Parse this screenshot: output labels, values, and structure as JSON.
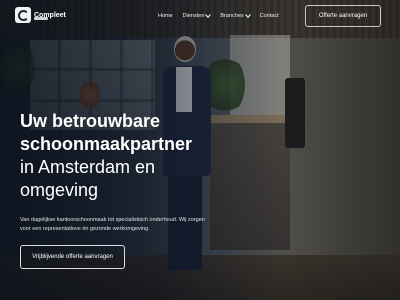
{
  "brand": {
    "name": "Compleet"
  },
  "nav": {
    "items": [
      {
        "label": "Home",
        "has_dropdown": false
      },
      {
        "label": "Diensten",
        "has_dropdown": true
      },
      {
        "label": "Branches",
        "has_dropdown": true
      },
      {
        "label": "Contact",
        "has_dropdown": false
      }
    ],
    "cta_label": "Offerte aanvragen"
  },
  "hero": {
    "title_strong": "Uw betrouwbare schoonmaakpartner",
    "title_rest": " in Amsterdam en omgeving",
    "description": "Van dagelijkse kantoorschoonmaak tot specialistisch onderhoud. Wij zorgen voor een representatieve én gezonde werkomgeving.",
    "cta_label": "Vrijblijvende offerte aanvragen"
  },
  "colors": {
    "overlay": "#0a101a",
    "text": "#ffffff",
    "suit": "#202a45"
  }
}
